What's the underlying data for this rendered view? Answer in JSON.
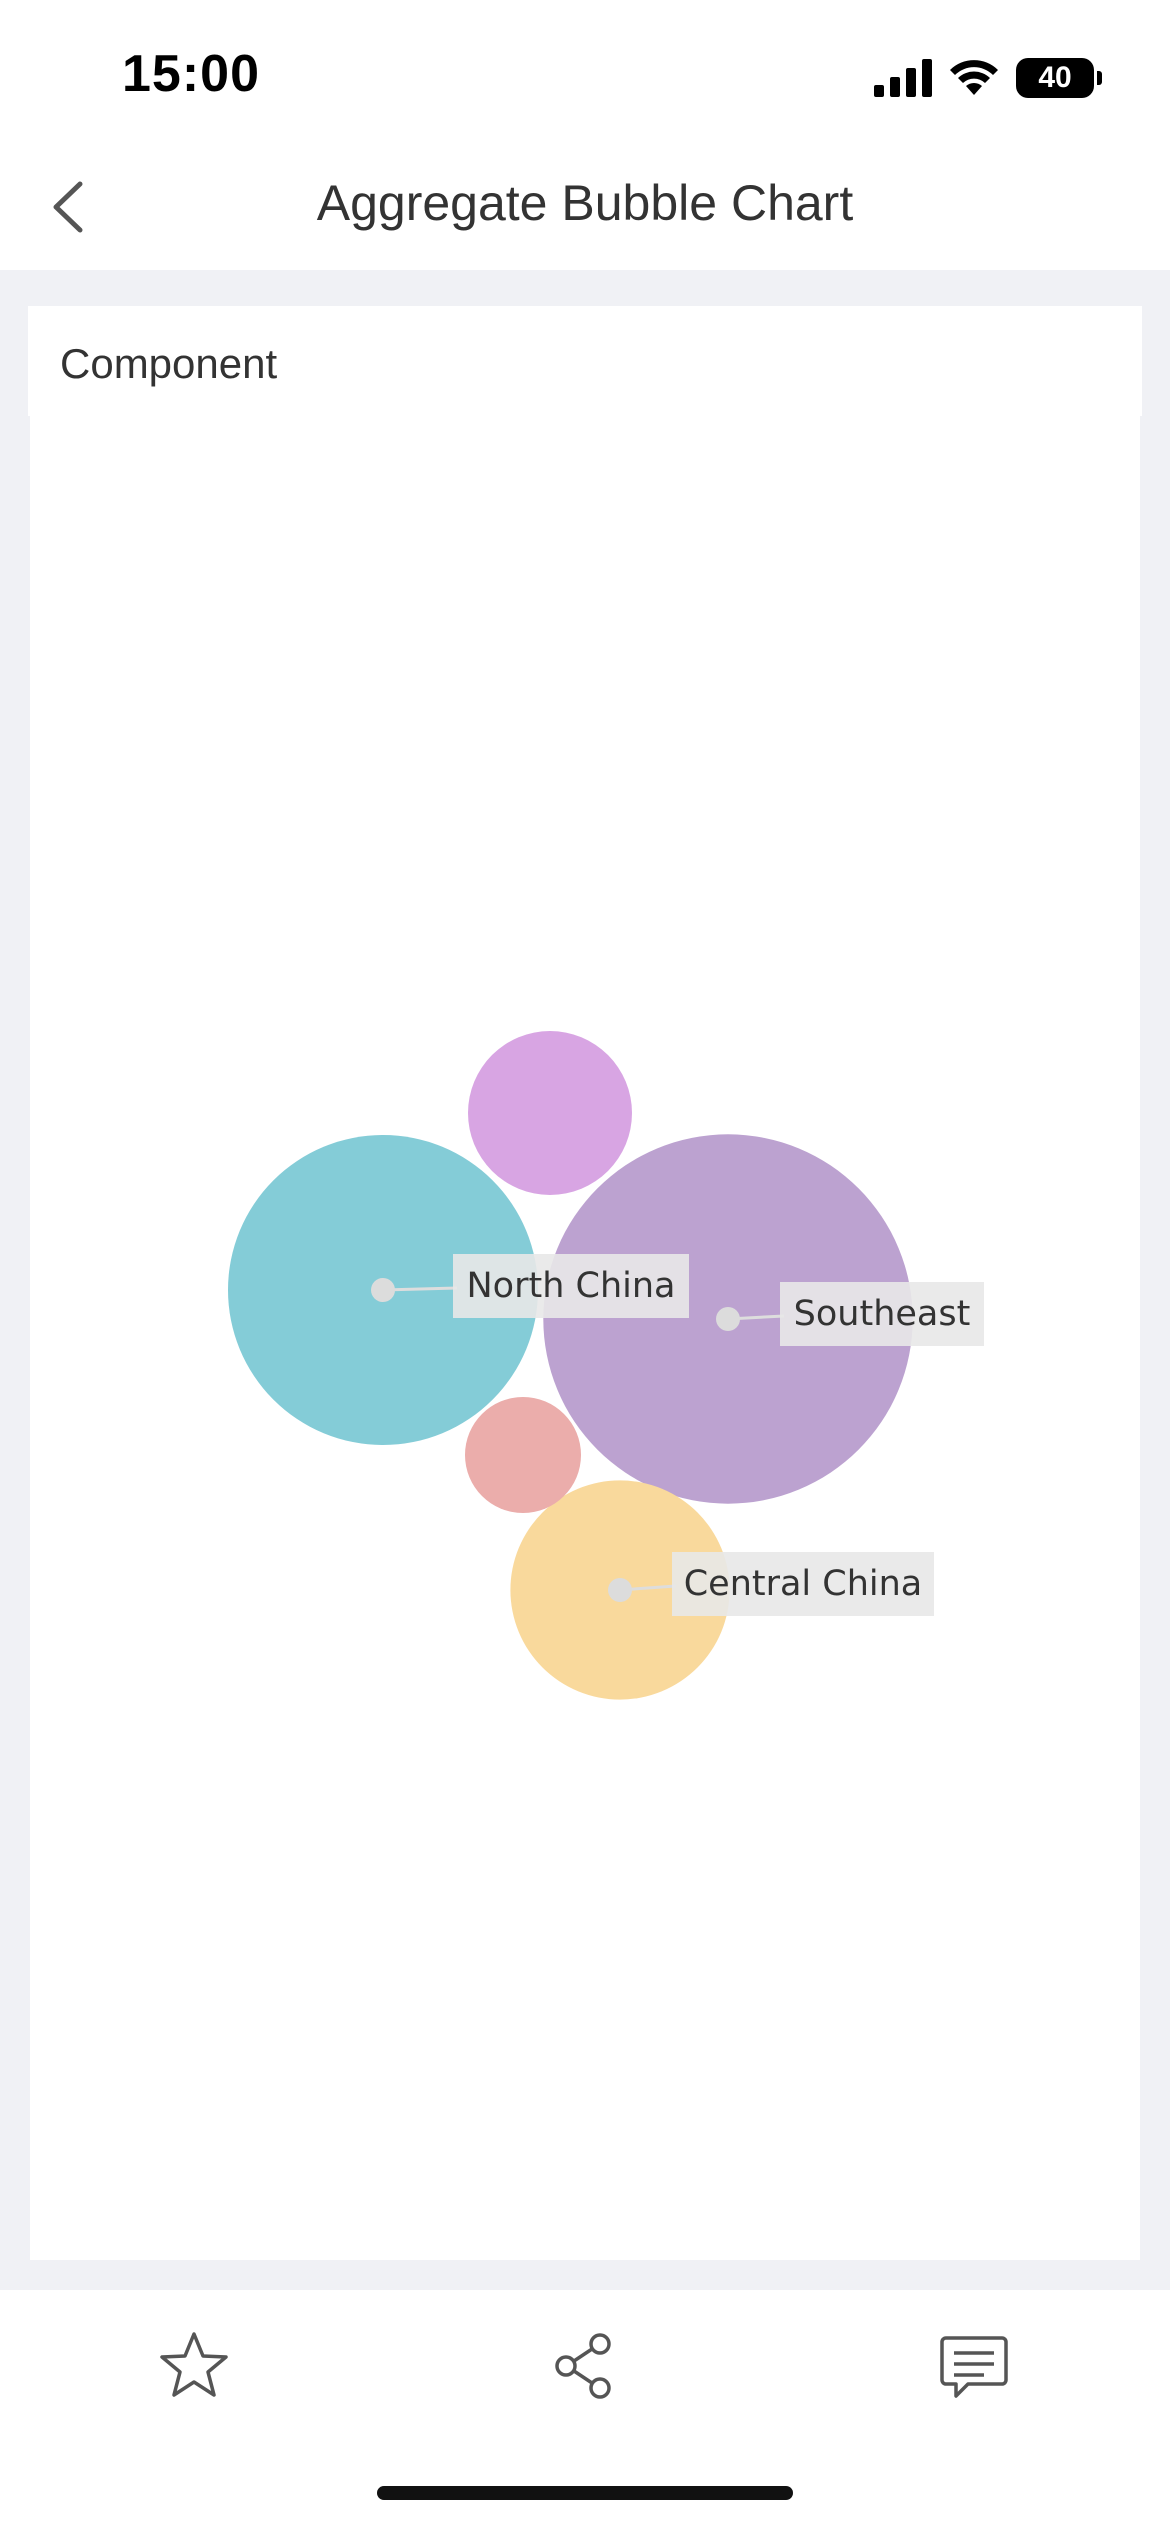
{
  "status_bar": {
    "time": "15:00",
    "battery": "40",
    "icons": [
      "signal-icon",
      "wifi-icon",
      "battery-icon"
    ]
  },
  "nav": {
    "title": "Aggregate Bubble Chart",
    "back_icon": "chevron-left-icon"
  },
  "card": {
    "title": "Component"
  },
  "chart_data": {
    "type": "bubble",
    "title": "",
    "bubbles": [
      {
        "label": "North China",
        "value": 100,
        "color": "#84ccd7",
        "labeled": true
      },
      {
        "label": "Southeast",
        "value": 142,
        "color": "#bca2d0",
        "labeled": true
      },
      {
        "label": "Central China",
        "value": 50,
        "color": "#f9d99c",
        "labeled": true
      },
      {
        "label": "",
        "value": 28,
        "color": "#d8a5e3",
        "labeled": false
      },
      {
        "label": "",
        "value": 14,
        "color": "#ebadab",
        "labeled": false
      }
    ]
  },
  "bottom_bar": {
    "icons": [
      "star-icon",
      "share-icon",
      "comment-icon"
    ]
  }
}
